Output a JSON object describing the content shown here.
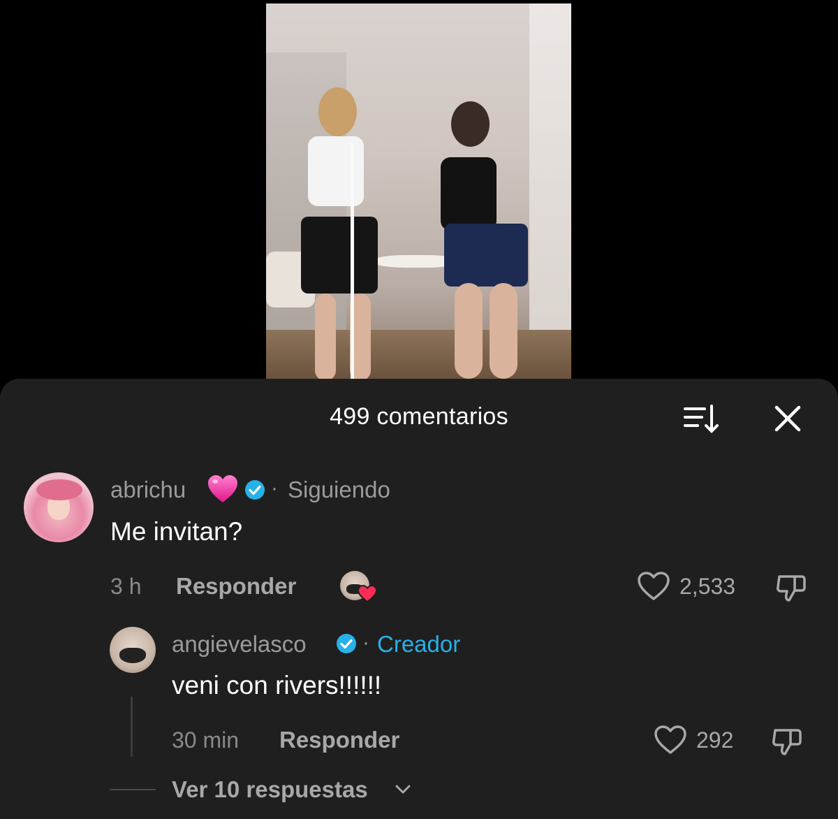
{
  "sheet": {
    "title": "499 comentarios"
  },
  "comments": [
    {
      "username": "abrichu",
      "status": "Siguiendo",
      "text": "Me invitan?",
      "time": "3 h",
      "reply_label": "Responder",
      "likes": "2,533"
    },
    {
      "username": "angievelasco",
      "status": "Creador",
      "text": "veni con rivers!!!!!!",
      "time": "30 min",
      "reply_label": "Responder",
      "likes": "292"
    }
  ],
  "more_replies": "Ver 10 respuestas",
  "colors": {
    "sheet_bg": "#1f1f1f",
    "creator_accent": "#27b1e8",
    "verified": "#27b1e8",
    "like_heart_mini": "#fe2c55",
    "pink_heart": "#ff4fb4"
  },
  "icons": {
    "sort": "sort-icon",
    "close": "close-icon",
    "like": "heart-outline-icon",
    "dislike": "thumbs-down-icon",
    "verified": "verified-badge-icon",
    "emoji": "pink-heart-emoji",
    "chevron": "chevron-down-icon"
  }
}
